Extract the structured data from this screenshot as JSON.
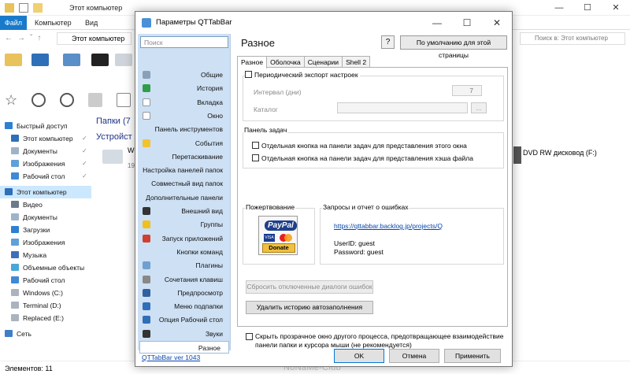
{
  "explorer": {
    "title": "Этот компьютер",
    "ribbon_tabs": {
      "file": "Файл",
      "computer": "Компьютер",
      "view": "Вид"
    },
    "address": "Этот компьютер",
    "search_placeholder": "Поиск в: Этот компьютер",
    "tree": [
      {
        "label": "Быстрый доступ"
      },
      {
        "label": "Этот компьютер"
      },
      {
        "label": "Документы"
      },
      {
        "label": "Изображения"
      },
      {
        "label": "Рабочий стол"
      },
      {
        "label": "Этот компьютер"
      },
      {
        "label": "Видео"
      },
      {
        "label": "Документы"
      },
      {
        "label": "Загрузки"
      },
      {
        "label": "Изображения"
      },
      {
        "label": "Музыка"
      },
      {
        "label": "Объемные объекты"
      },
      {
        "label": "Рабочий стол"
      },
      {
        "label": "Windows (C:)"
      },
      {
        "label": "Terminal (D:)"
      },
      {
        "label": "Replaced (E:)"
      },
      {
        "label": "Сеть"
      }
    ],
    "content": {
      "folders_label": "Папки (7",
      "devices_label": "Устройст",
      "drive_label": "DVD RW дисковод (F:)",
      "partial_name": "Wi",
      "partial_size": "19"
    },
    "status": "Элементов: 11",
    "watermark": "NoNaMe-Club"
  },
  "dialog": {
    "title": "Параметры QTTabBar",
    "search_placeholder": "Поиск",
    "categories": [
      {
        "label": "Общие",
        "icon": "gear-icon"
      },
      {
        "label": "История",
        "icon": "history-icon"
      },
      {
        "label": "Вкладка",
        "icon": "tab-icon"
      },
      {
        "label": "Окно",
        "icon": "window-icon"
      },
      {
        "label": "Панель инструментов",
        "icon": ""
      },
      {
        "label": "События",
        "icon": "lightning-icon"
      },
      {
        "label": "Перетаскивание",
        "icon": ""
      },
      {
        "label": "Настройка панелей папок",
        "icon": ""
      },
      {
        "label": "Совместный вид папок",
        "icon": ""
      },
      {
        "label": "Дополнительные панели",
        "icon": ""
      },
      {
        "label": "Внешний вид",
        "icon": "eye-icon"
      },
      {
        "label": "Группы",
        "icon": "star-icon"
      },
      {
        "label": "Запуск приложений",
        "icon": "app-icon"
      },
      {
        "label": "Кнопки команд",
        "icon": ""
      },
      {
        "label": "Плагины",
        "icon": "plugin-icon"
      },
      {
        "label": "Сочетания клавиш",
        "icon": "keyboard-icon"
      },
      {
        "label": "Предпросмотр",
        "icon": "search-icon"
      },
      {
        "label": "Меню подпапки",
        "icon": "menu-icon"
      },
      {
        "label": "Опция Рабочий стол",
        "icon": "desktop-icon"
      },
      {
        "label": "Звуки",
        "icon": "speaker-icon"
      },
      {
        "label": "Разное",
        "icon": ""
      }
    ],
    "version_link": "QTTabBar ver 1043",
    "page_title": "Разное",
    "help_label": "?",
    "default_button": "По умолчанию для этой страницы",
    "tabs": [
      "Разное",
      "Оболочка",
      "Сценарии",
      "Shell 2"
    ],
    "periodic_export": "Периодический экспорт настроек",
    "interval_label": "Интервал (дни)",
    "interval_value": "7",
    "catalog_label": "Каталог",
    "browse_label": "...",
    "taskbar_group": "Панель задач",
    "taskbar_opt1": "Отдельная кнопка на панели задач для представления этого окна",
    "taskbar_opt2": "Отдельная кнопка на панели задач для представления хэша файла",
    "donation_label": "Пожертвование",
    "paypal_word": "PayPal",
    "visa": "VISA",
    "donate": "Donate",
    "requests_label": "Запросы и отчет о ошибках",
    "bug_link": "https://qttabbar.backlog.jp/projects/Q",
    "user_id": "UserID:  guest",
    "password": "Password:  guest",
    "reset_dialogs": "Сбросить отключенные диалоги ошибок",
    "clear_history": "Удалить историю автозаполнения",
    "hide_window": "Скрыть прозрачное окно другого процесса, предотвращающее взаимодействие панели папки и курсора мыши (не рекомендуется)",
    "ok": "OK",
    "cancel": "Отмена",
    "apply": "Применить"
  }
}
